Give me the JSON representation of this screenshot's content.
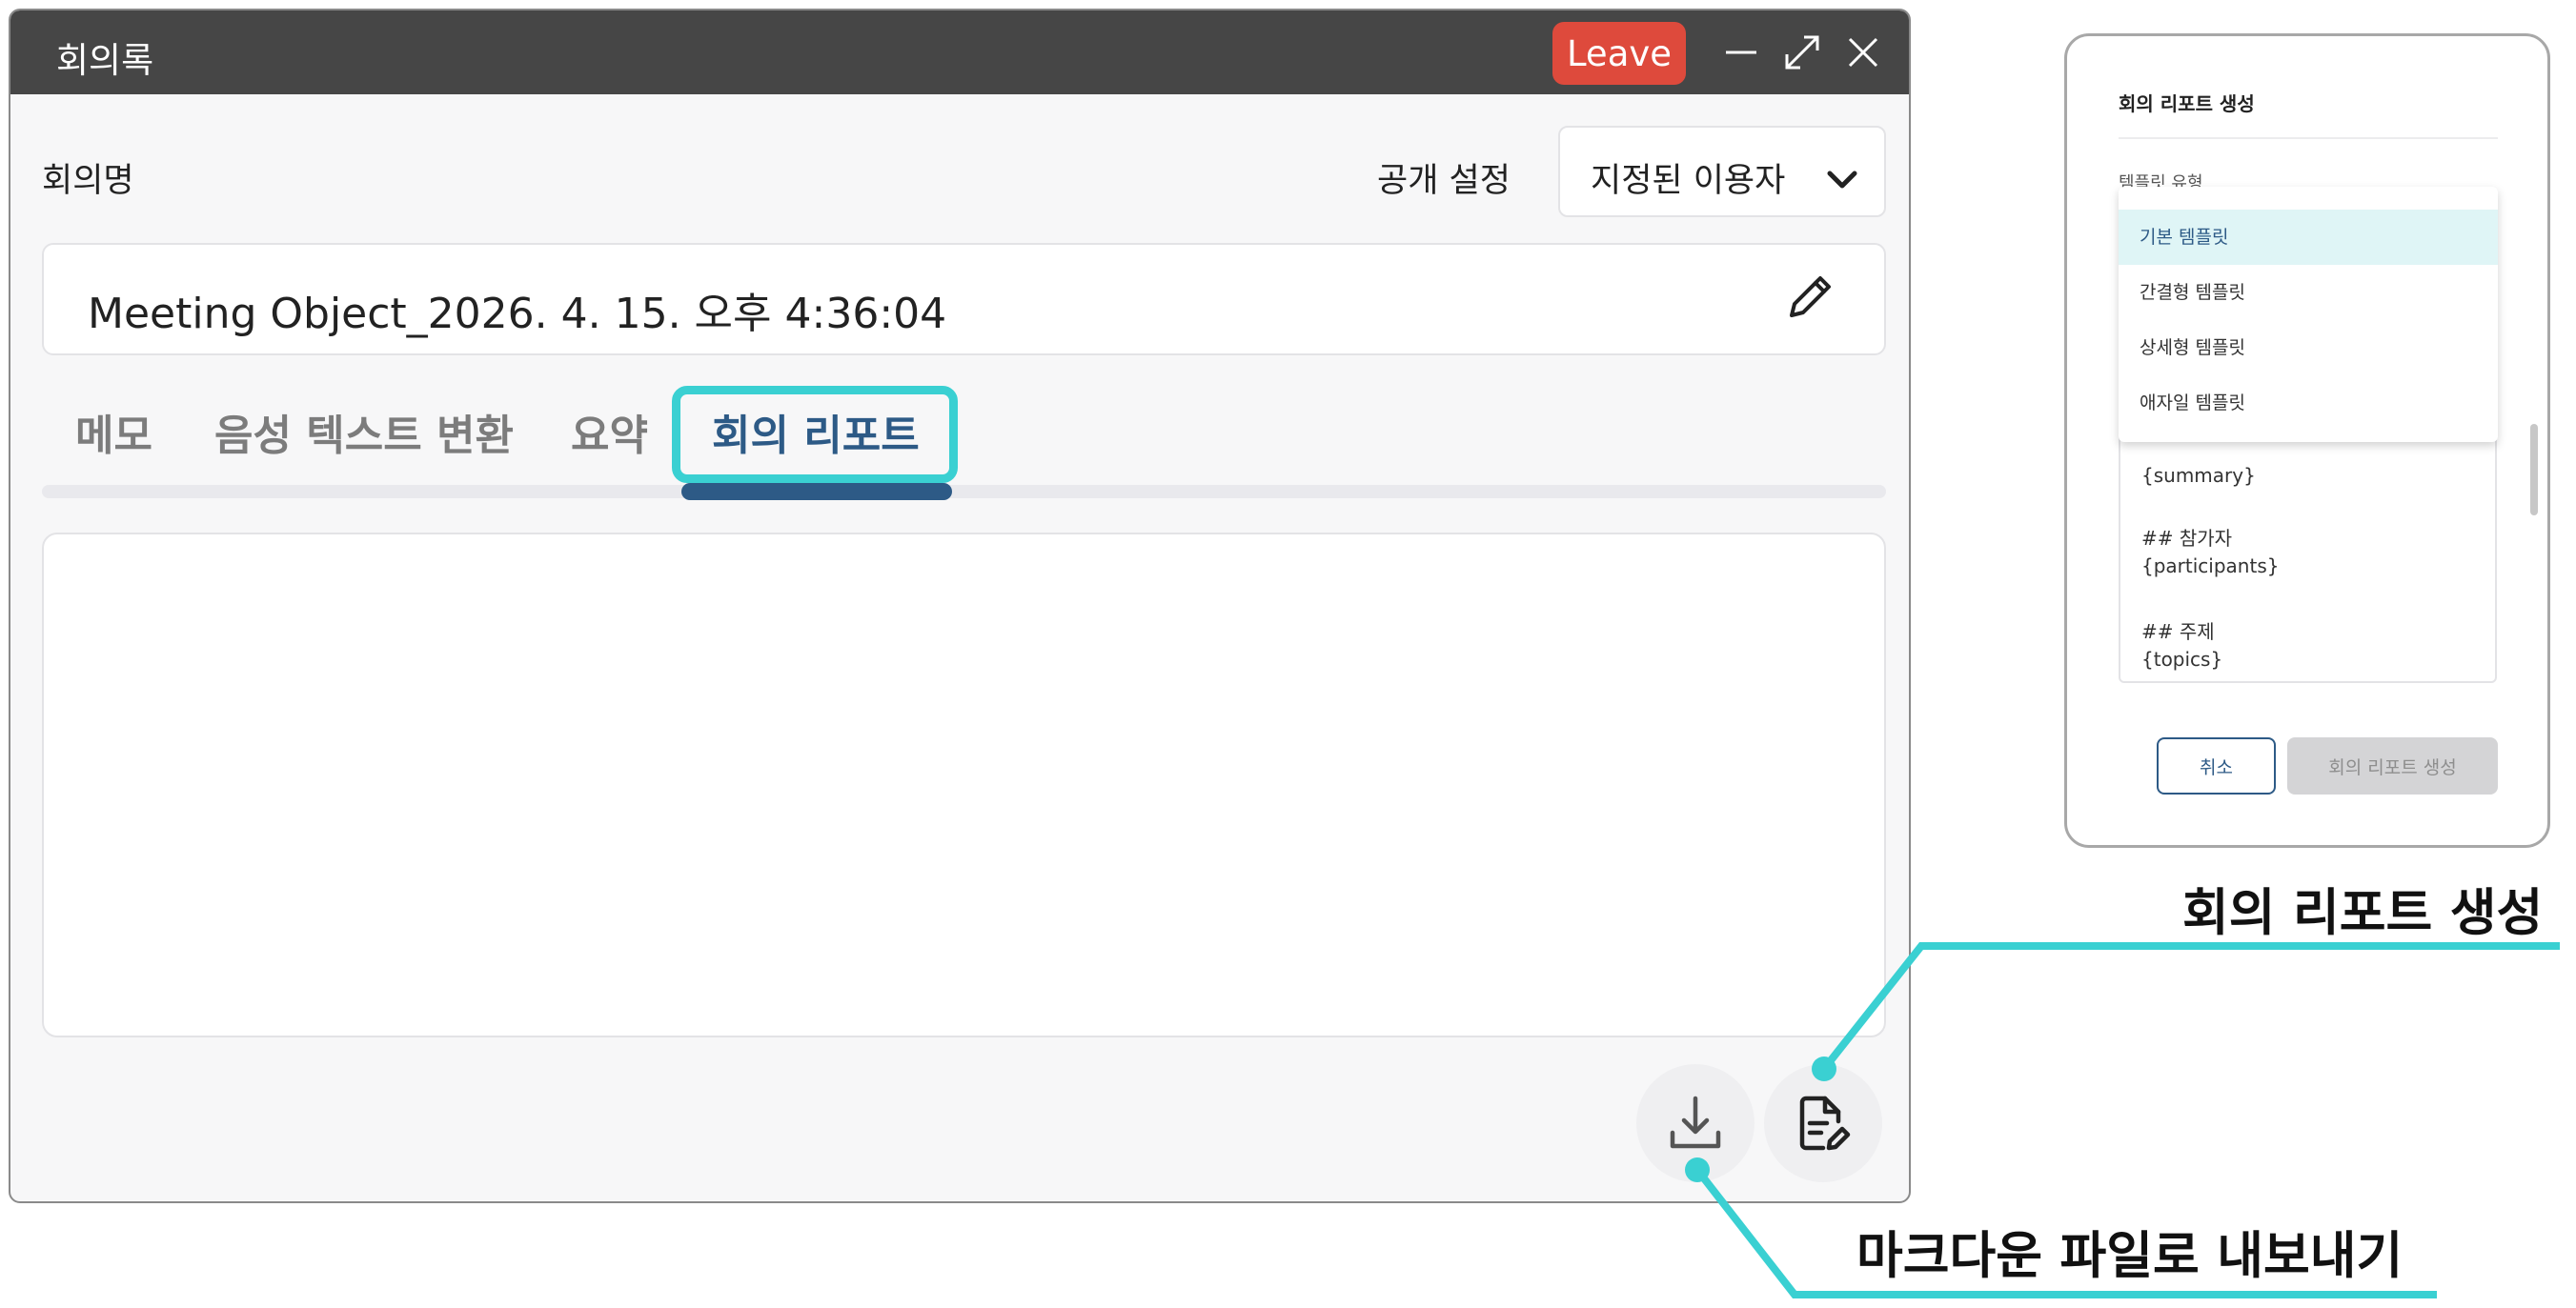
{
  "window": {
    "title": "회의록",
    "leave_label": "Leave",
    "meeting_name_label": "회의명",
    "visibility_label": "공개 설정",
    "visibility_value": "지정된 이용자",
    "meeting_name_value": "Meeting Object_2026. 4. 15. 오후 4:36:04",
    "tabs": [
      {
        "label": "메모"
      },
      {
        "label": "음성 텍스트 변환"
      },
      {
        "label": "요약"
      },
      {
        "label": "회의 리포트"
      }
    ],
    "active_tab": "회의 리포트"
  },
  "dialog": {
    "title": "회의 리포트 생성",
    "template_label": "템플릿 유형",
    "dropdown_options": [
      "기본 템플릿",
      "간결형 템플릿",
      "상세형 템플릿",
      "애자일 템플릿"
    ],
    "selected_option": "기본 템플릿",
    "template_lines": [
      "{summary}",
      "## 참가자",
      "{participants}",
      "## 주제",
      "{topics}"
    ],
    "cancel_label": "취소",
    "create_label": "회의 리포트 생성"
  },
  "annotations": {
    "create_report": "회의 리포트 생성",
    "export_markdown": "마크다운 파일로 내보내기"
  },
  "colors": {
    "titlebar": "#464646",
    "leave": "#de4a3c",
    "accent": "#2d5a86",
    "highlight": "#3ad0d2",
    "dropdown_selected": "#dff5f6"
  }
}
